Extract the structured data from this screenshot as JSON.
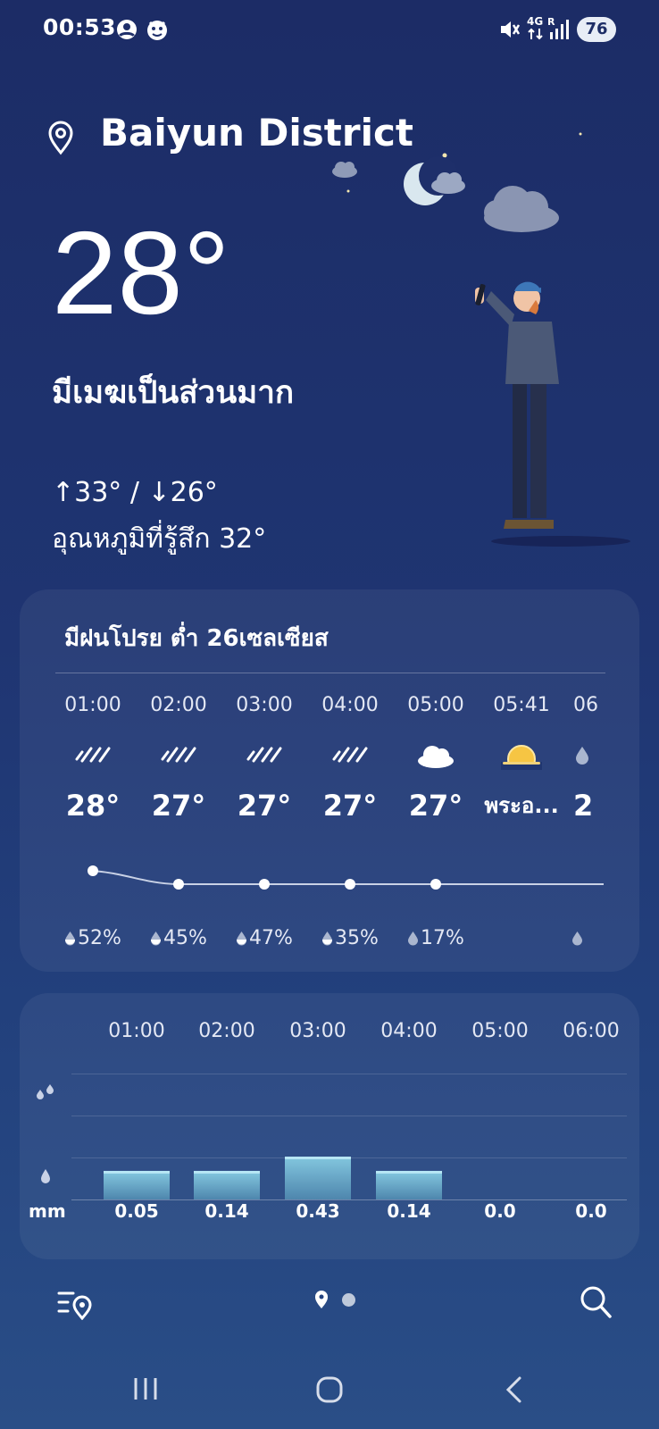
{
  "status_bar": {
    "time": "00:53",
    "battery": "76",
    "network": "4G",
    "icons": [
      "account-icon",
      "app-notification-icon",
      "mute-icon",
      "signal-icon"
    ]
  },
  "header": {
    "location": "Baiyun District",
    "temperature": "28°",
    "condition": "มีเมฆเป็นส่วนมาก",
    "hi_lo": "↑33° / ↓26°",
    "feels_like": "อุณหภูมิที่รู้สึก 32°"
  },
  "hourly": {
    "summary": "มีฝนโปรย ต่ำ 26เซลเซียส",
    "items": [
      {
        "time": "01:00",
        "icon": "drizzle-icon",
        "temp": "28°",
        "precip": "52%"
      },
      {
        "time": "02:00",
        "icon": "drizzle-icon",
        "temp": "27°",
        "precip": "45%"
      },
      {
        "time": "03:00",
        "icon": "drizzle-icon",
        "temp": "27°",
        "precip": "47%"
      },
      {
        "time": "04:00",
        "icon": "drizzle-icon",
        "temp": "27°",
        "precip": "35%"
      },
      {
        "time": "05:00",
        "icon": "cloud-icon",
        "temp": "27°",
        "precip": "17%"
      },
      {
        "time": "05:41",
        "icon": "sunrise-icon",
        "temp": "พระอ..."
      },
      {
        "time": "06",
        "icon": "partial-icon",
        "temp": "2"
      }
    ],
    "trend_temps": [
      28,
      27,
      27,
      27,
      27
    ]
  },
  "precipitation": {
    "unit": "mm",
    "times": [
      "01:00",
      "02:00",
      "03:00",
      "04:00",
      "05:00",
      "06:00"
    ],
    "values": [
      "0.05",
      "0.14",
      "0.43",
      "0.14",
      "0.0",
      "0.0"
    ],
    "bar_levels": [
      0.66,
      0.66,
      1.0,
      0.66,
      0,
      0
    ]
  },
  "colors": {
    "background_top": "#1c2c66",
    "background_bottom": "#2a4e87",
    "bar": "#6aa8c9"
  }
}
